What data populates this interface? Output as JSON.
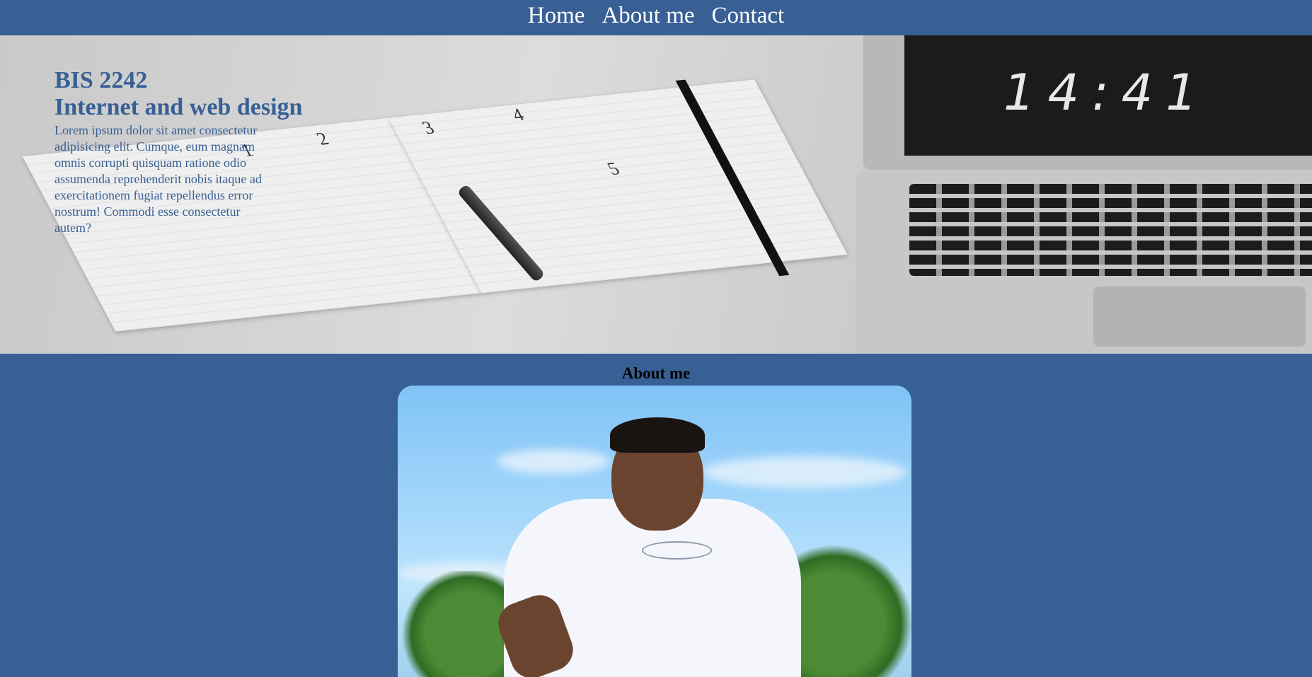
{
  "nav": {
    "home": "Home",
    "about": "About me",
    "contact": "Contact"
  },
  "hero": {
    "course_code": "BIS 2242",
    "course_title": "Internet and web design",
    "description": "Lorem ipsum dolor sit amet consectetur adipisicing elit. Cumque, eum magnam omnis corrupti quisquam ratione odio assumenda reprehenderit nobis itaque ad exercitationem fugiat repellendus error nostrum! Commodi esse consectetur autem?",
    "clock_text": "14:41",
    "page_numbers": [
      "1",
      "2",
      "3",
      "4",
      "5"
    ]
  },
  "about": {
    "heading": "About me"
  },
  "colors": {
    "primary": "#386094",
    "nav_text": "#ffffff"
  }
}
